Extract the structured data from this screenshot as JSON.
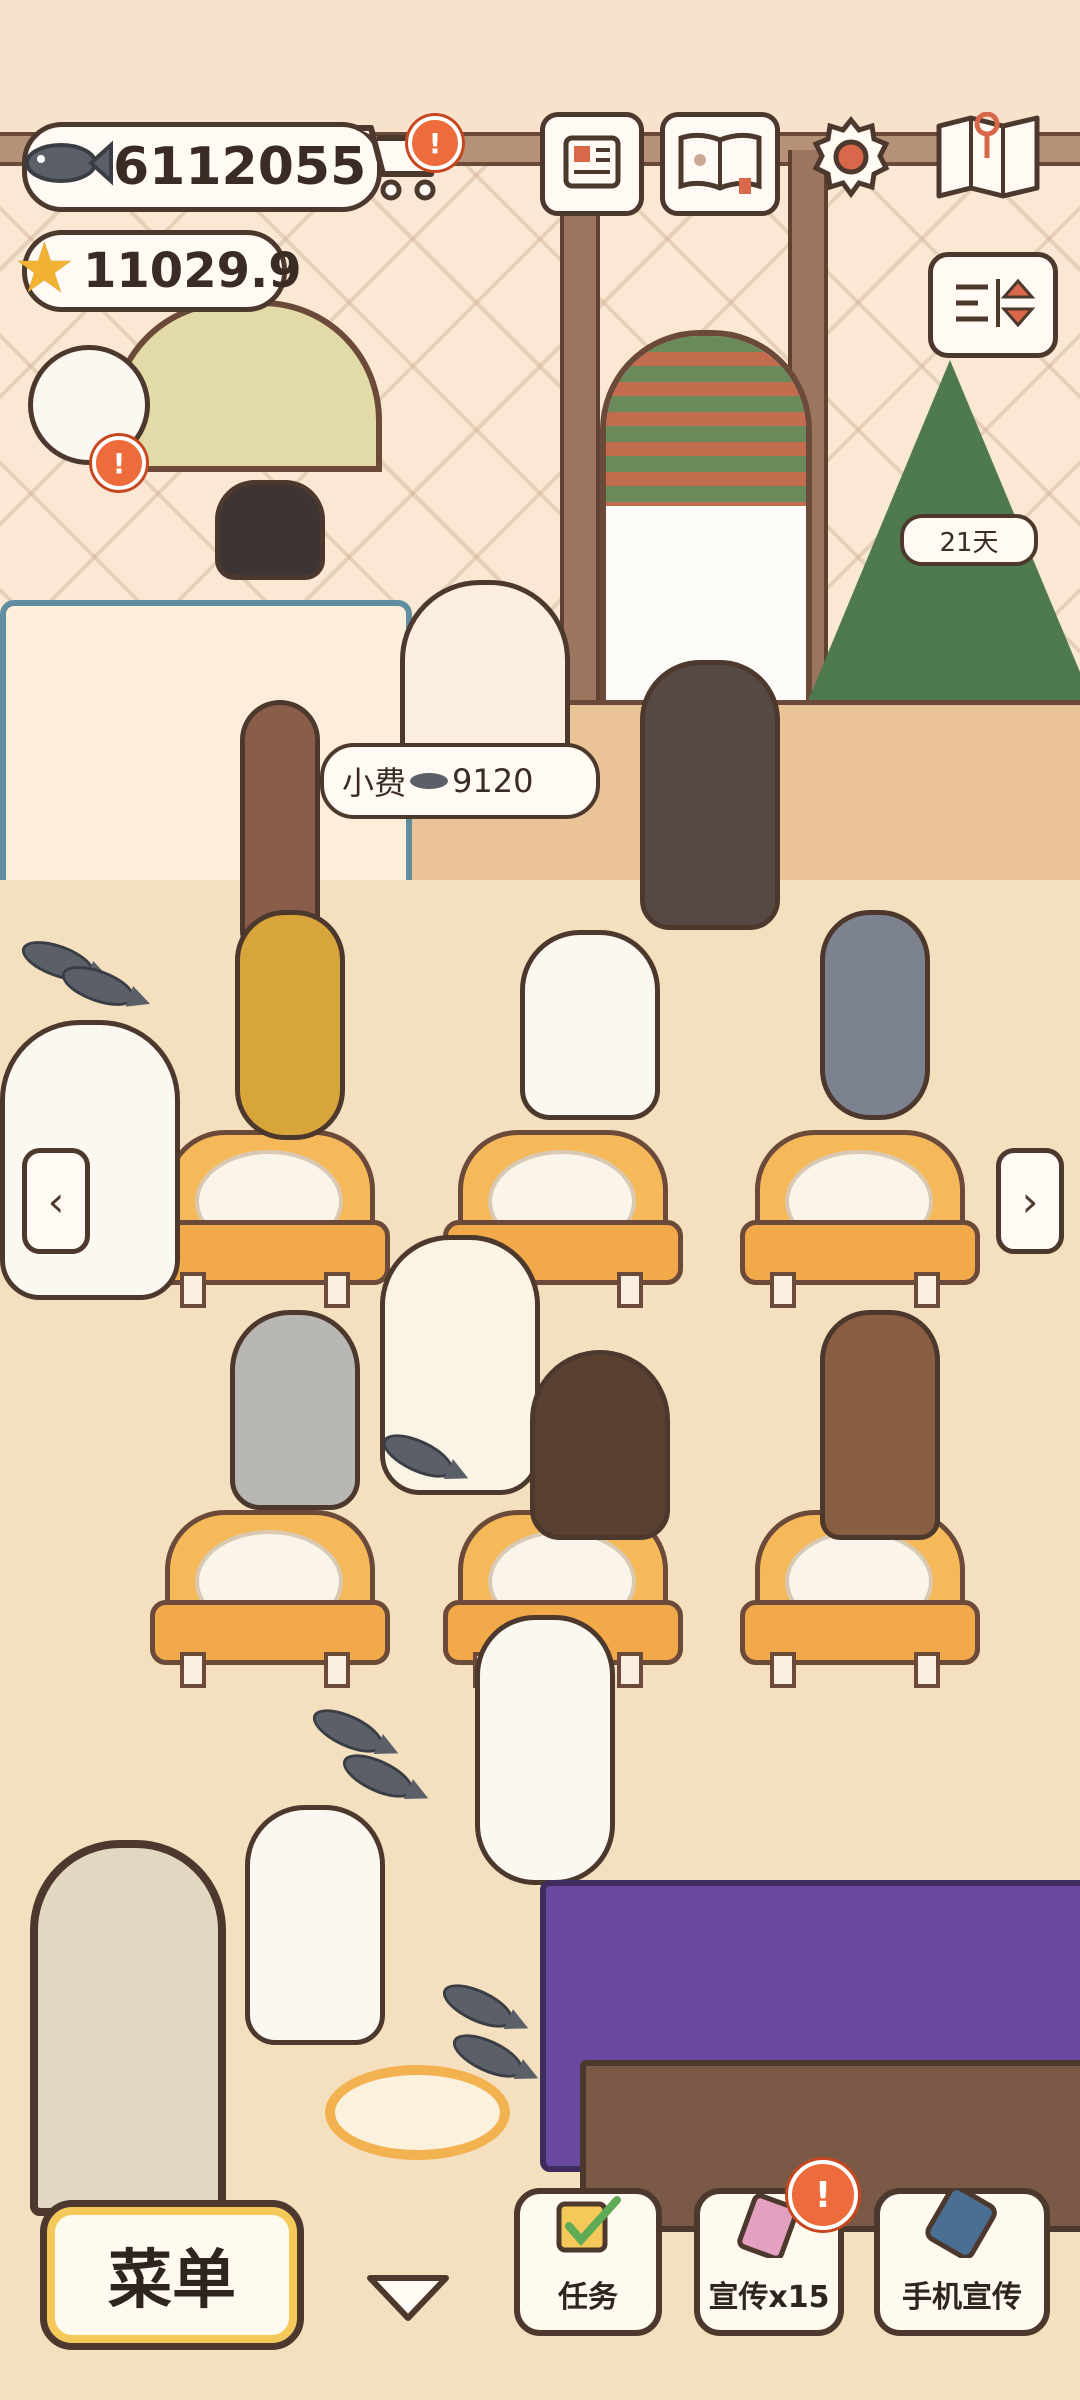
{
  "hud": {
    "fish_currency": "6112055",
    "rating": "11029.9"
  },
  "top_icons": [
    {
      "name": "shop-cart-icon"
    },
    {
      "name": "newspaper-icon"
    },
    {
      "name": "cat-book-icon"
    },
    {
      "name": "settings-gear-icon"
    },
    {
      "name": "map-icon"
    }
  ],
  "alerts": {
    "shop": "!",
    "customer": "!",
    "promote": "!"
  },
  "tree": {
    "days_label": "21天"
  },
  "tip": {
    "label": "小费",
    "amount": "9120"
  },
  "nav": {
    "left_arrow": "‹",
    "right_arrow": "›"
  },
  "bottom_bar": {
    "menu_label": "菜单",
    "task_label": "任务",
    "promote_label": "宣传x15",
    "phone_promote_label": "手机宣传"
  },
  "colors": {
    "outline": "#4d382d",
    "alert": "#ee6b3b",
    "table_orange": "#f6b959",
    "background": "#f7e4c8"
  }
}
